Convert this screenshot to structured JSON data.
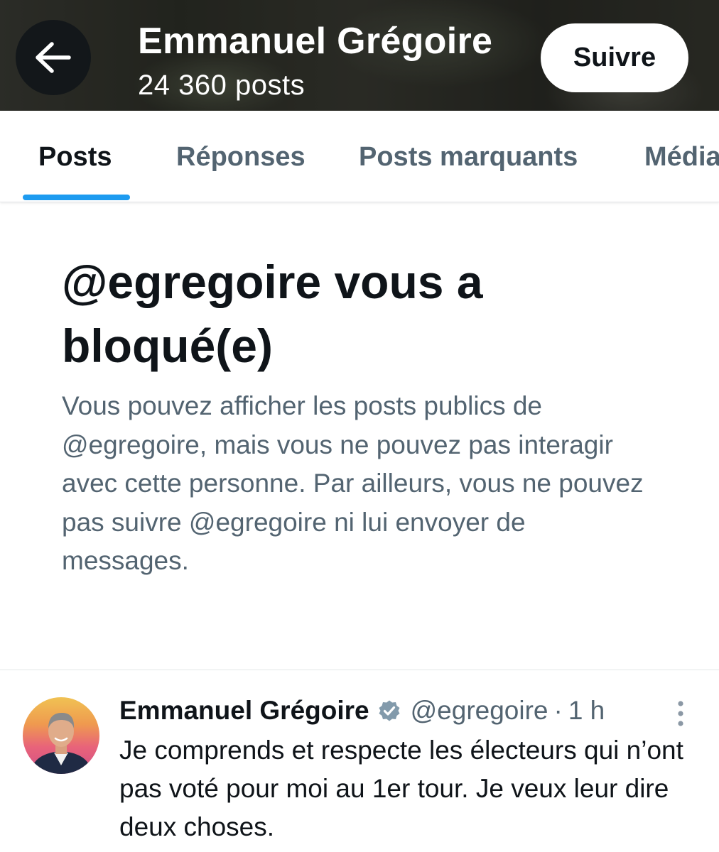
{
  "header": {
    "name": "Emmanuel Grégoire",
    "post_count": "24 360 posts",
    "follow_label": "Suivre"
  },
  "tabs": [
    {
      "label": "Posts",
      "active": true
    },
    {
      "label": "Réponses",
      "active": false
    },
    {
      "label": "Posts marquants",
      "active": false
    },
    {
      "label": "Média",
      "active": false
    }
  ],
  "blocked": {
    "title": "@egregoire vous a bloqué(e)",
    "description": "Vous pouvez afficher les posts publics de @egregoire, mais vous ne pouvez pas interagir avec cette personne. Par ailleurs, vous ne pouvez pas suivre @egregoire ni lui envoyer de messages."
  },
  "post": {
    "author": "Emmanuel Grégoire",
    "handle": "@egregoire",
    "separator": "·",
    "time": "1 h",
    "text": "Je comprends et respecte les électeurs qui n’ont pas voté pour moi au 1er tour. Je veux leur dire deux choses."
  },
  "colors": {
    "accent": "#1d9bf0",
    "text_primary": "#0f1419",
    "text_secondary": "#536471",
    "verified_badge": "#829aab"
  },
  "icons": {
    "back": "arrow-left-icon",
    "verified": "verified-badge-icon",
    "more": "more-vertical-icon"
  }
}
